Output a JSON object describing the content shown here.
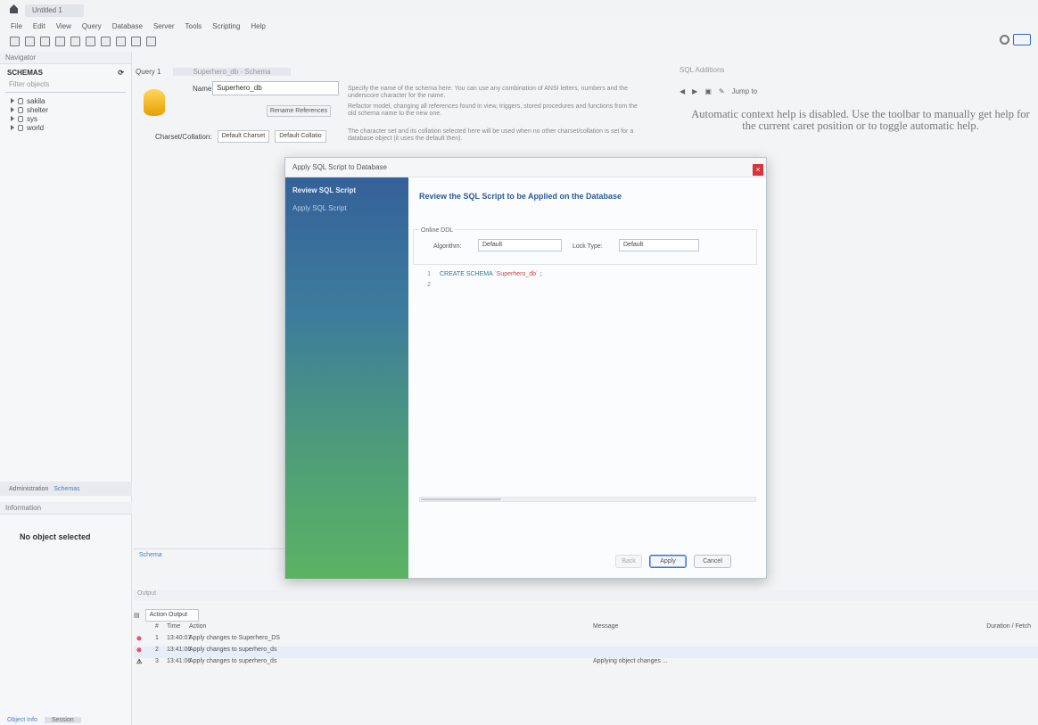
{
  "window": {
    "connection_tab": "Untitled 1"
  },
  "menu": [
    "File",
    "Edit",
    "View",
    "Query",
    "Database",
    "Server",
    "Tools",
    "Scripting",
    "Help"
  ],
  "navigator": {
    "header": "Navigator",
    "schemas_label": "SCHEMAS",
    "filter_placeholder": "Filter objects",
    "schemas": [
      "sakila",
      "shelter",
      "sys",
      "world"
    ],
    "admin_tab": "Administration",
    "schemas_tab": "Schemas",
    "info_header": "Information",
    "no_object": "No object selected",
    "bottom_tabs": [
      "Object Info",
      "Session"
    ]
  },
  "editor": {
    "tabs": [
      "Query 1",
      "Superhero_db - Schema"
    ],
    "name_label": "Name:",
    "name_value": "Superhero_db",
    "rename_button": "Rename References",
    "charset_label": "Charset/Collation:",
    "charset_value": "Default Charset",
    "collation_value": "Default Collatio",
    "desc1": "Specify the name of the schema here. You can use any combination of ANSI letters, numbers and the underscore character for the name.",
    "desc2": "Refactor model, changing all references found in view, triggers, stored procedures and functions from the old schema name to the new one.",
    "desc3": "The character set and its collation selected here will be used when no other charset/collation is set for a database object (it uses the default then).",
    "bottom_tab": "Schema"
  },
  "help": {
    "header": "SQL Additions",
    "nav_jump": "Jump to",
    "text": "Automatic context help is disabled. Use the toolbar to manually get help for the current caret position or to toggle automatic help."
  },
  "dialog": {
    "title": "Apply SQL Script to Database",
    "close": "×",
    "steps": [
      "Review SQL Script",
      "Apply SQL Script"
    ],
    "heading": "Review the SQL Script to be Applied on the Database",
    "options_label": "Online DDL",
    "algorithm_label": "Algorithm:",
    "algorithm_value": "Default",
    "lock_label": "Lock Type:",
    "lock_value": "Default",
    "sql_lines": [
      {
        "no": "1",
        "kw": "CREATE SCHEMA",
        "str": "`Superhero_db`",
        "tail": " ;"
      },
      {
        "no": "2",
        "kw": "",
        "str": "",
        "tail": ""
      }
    ],
    "back_button": "Back",
    "apply_button": "Apply",
    "cancel_button": "Cancel"
  },
  "output": {
    "header": "Output",
    "selector": "Action Output",
    "columns": {
      "num": "#",
      "time": "Time",
      "action": "Action",
      "message": "Message",
      "duration": "Duration / Fetch"
    },
    "rows": [
      {
        "status": "error",
        "num": "1",
        "time": "13:40:07",
        "action": "Apply changes to Superhero_DS",
        "message": "",
        "duration": ""
      },
      {
        "status": "error",
        "num": "2",
        "time": "13:41:06",
        "action": "Apply changes to superhero_ds",
        "message": "",
        "duration": ""
      },
      {
        "status": "warning",
        "num": "3",
        "time": "13:41:06",
        "action": "Apply changes to superhero_ds",
        "message": "Applying object changes ...",
        "duration": ""
      }
    ]
  },
  "colors": {
    "accent": "#3b72d9",
    "close": "#d8343a",
    "error": "#dd2233"
  }
}
